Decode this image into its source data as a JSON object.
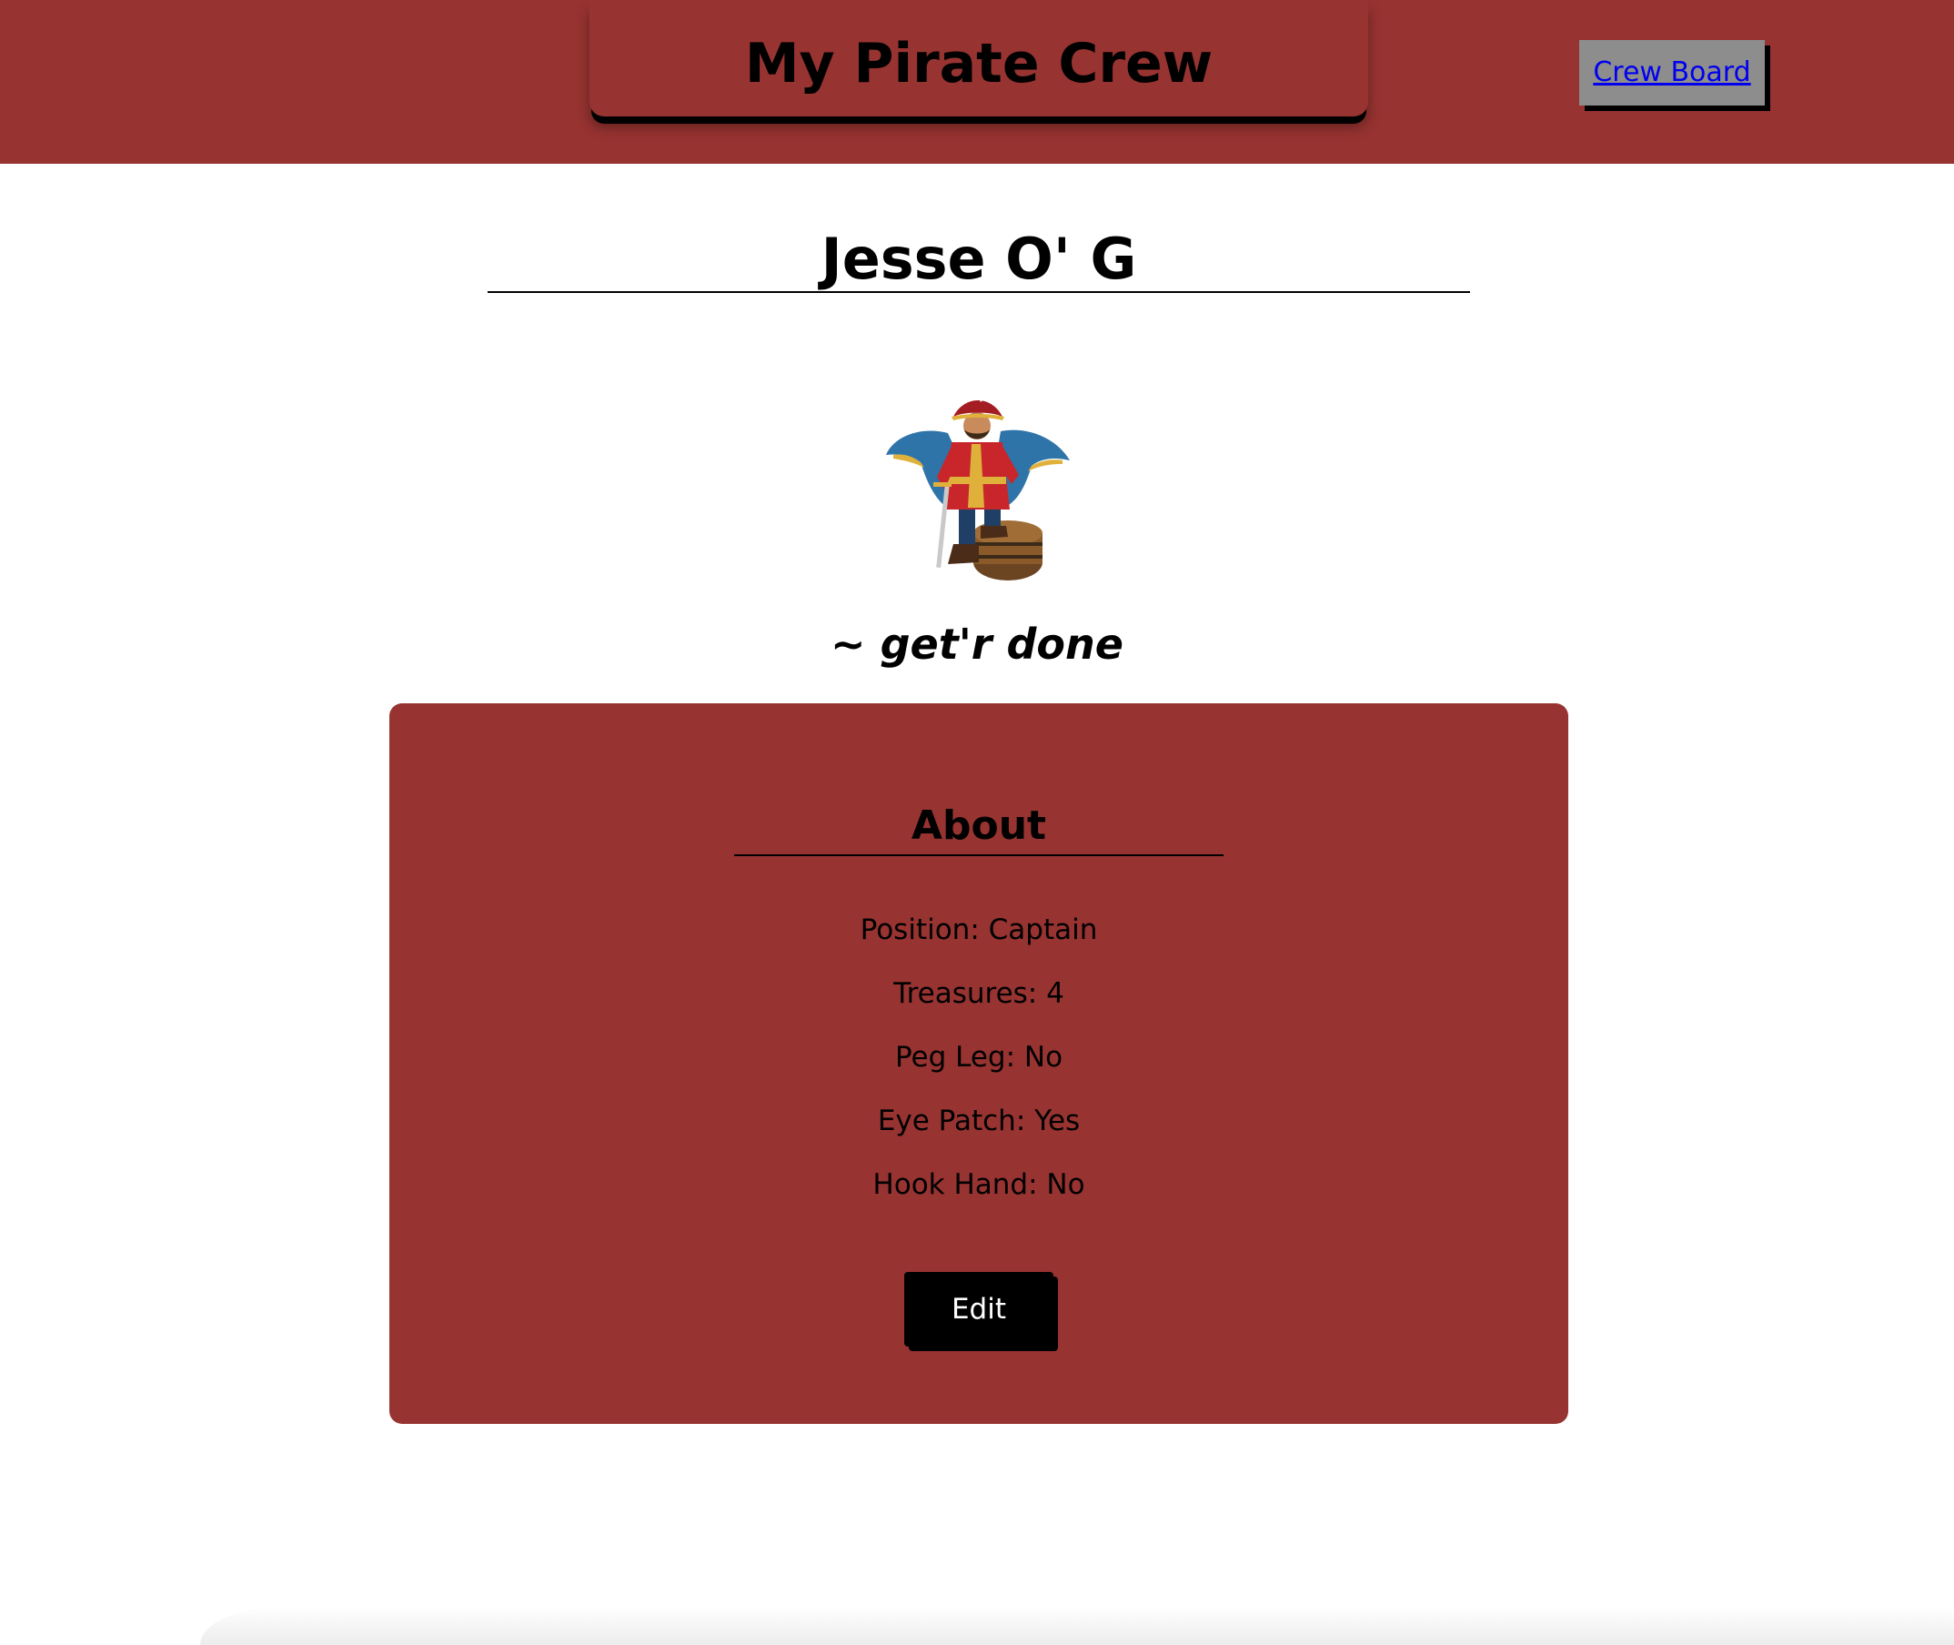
{
  "header": {
    "title": "My Pirate Crew",
    "nav_link": "Crew Board"
  },
  "profile": {
    "name": "Jesse O' G",
    "avatar_alt": "pirate-captain-illustration",
    "motto": "~ get'r done"
  },
  "about": {
    "heading": "About",
    "items": [
      "Position: Captain",
      "Treasures: 4",
      "Peg Leg: No",
      "Eye Patch: Yes",
      "Hook Hand: No"
    ],
    "edit_label": "Edit"
  },
  "colors": {
    "brand": "#973331",
    "button": "#000000",
    "nav_button": "#8d8d8d",
    "link": "#0000ee"
  }
}
